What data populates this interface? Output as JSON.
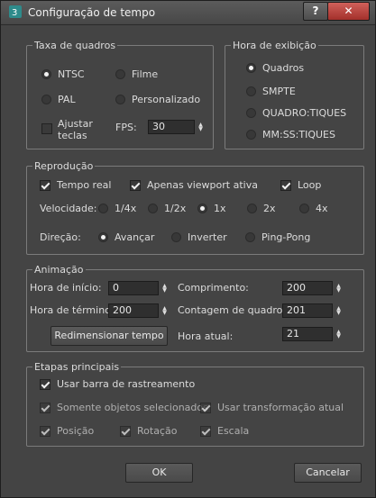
{
  "window": {
    "title": "Configuração de tempo",
    "help": "?",
    "close": "✕"
  },
  "frame_rate": {
    "legend": "Taxa de quadros",
    "ntsc": "NTSC",
    "film": "Filme",
    "pal": "PAL",
    "custom": "Personalizado",
    "adjust_keys_1": "Ajustar",
    "adjust_keys_2": "teclas",
    "fps_label": "FPS:",
    "fps_value": "30"
  },
  "time_display": {
    "legend": "Hora de exibição",
    "frames": "Quadros",
    "smpte": "SMPTE",
    "frame_ticks": "QUADRO:TIQUES",
    "mmss_ticks": "MM:SS:TIQUES"
  },
  "playback": {
    "legend": "Reprodução",
    "real_time": "Tempo real",
    "active_viewport": "Apenas viewport ativa",
    "loop": "Loop",
    "speed_label": "Velocidade:",
    "speeds": [
      "1/4x",
      "1/2x",
      "1x",
      "2x",
      "4x"
    ],
    "speed_selected": "1x",
    "direction_label": "Direção:",
    "directions": [
      "Avançar",
      "Inverter",
      "Ping-Pong"
    ],
    "direction_selected": "Avançar"
  },
  "animation": {
    "legend": "Animação",
    "start_label": "Hora de início:",
    "start_value": "0",
    "end_label": "Hora de término:",
    "end_value": "200",
    "length_label": "Comprimento:",
    "length_value": "200",
    "frame_count_label": "Contagem de quadros:",
    "frame_count_value": "201",
    "rescale_button": "Redimensionar tempo",
    "current_label": "Hora atual:",
    "current_value": "21"
  },
  "key_steps": {
    "legend": "Etapas principais",
    "use_trackbar": "Usar barra de rastreamento",
    "selected_only": "Somente objetos selecionados",
    "use_transform": "Usar transformação atual",
    "position": "Posição",
    "rotation": "Rotação",
    "scale": "Escala"
  },
  "footer": {
    "ok": "OK",
    "cancel": "Cancelar"
  },
  "colors": {
    "background": "#444444",
    "titlebar": "#4f4f4f",
    "close_button": "#c0433d",
    "field": "#2f2f2f"
  }
}
